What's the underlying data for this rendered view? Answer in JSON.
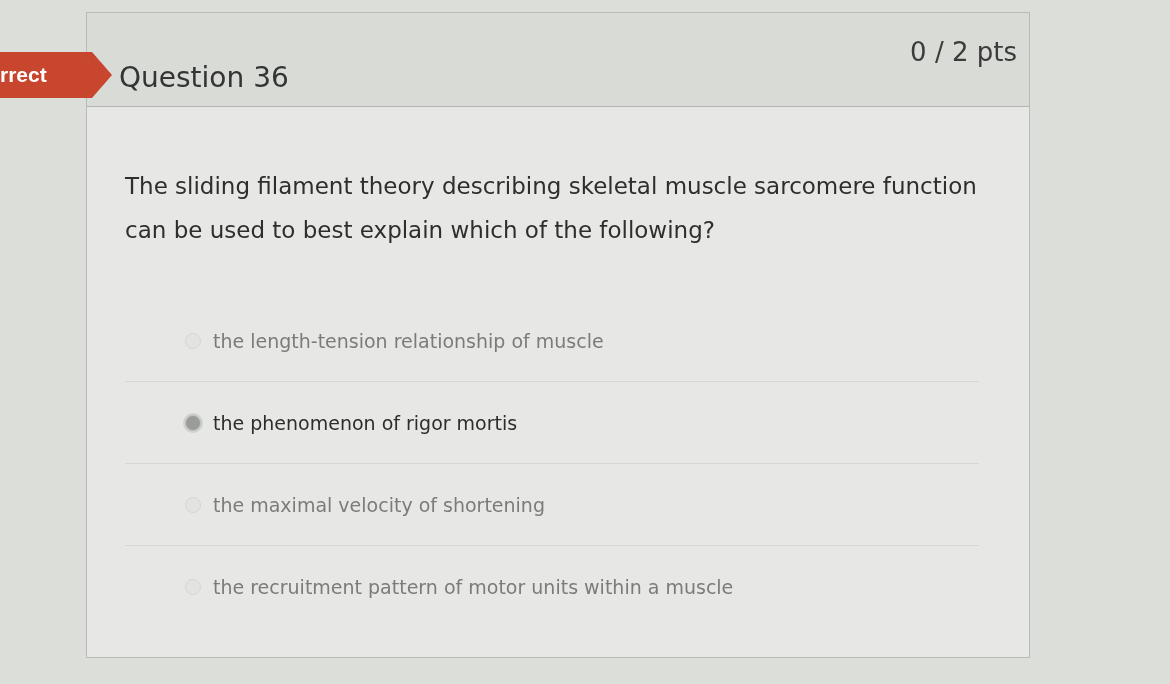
{
  "result_badge": {
    "text": "rrect"
  },
  "question": {
    "title": "Question 36",
    "score": "0 / 2 pts",
    "text": "The sliding filament theory describing skeletal muscle sarcomere function can be used to best explain which of the following?",
    "answers": [
      {
        "label": "the length-tension relationship of muscle",
        "selected": false
      },
      {
        "label": "the phenomenon of rigor mortis",
        "selected": true
      },
      {
        "label": "the maximal velocity of shortening",
        "selected": false
      },
      {
        "label": "the recruitment pattern of motor units within a muscle",
        "selected": false
      }
    ]
  }
}
